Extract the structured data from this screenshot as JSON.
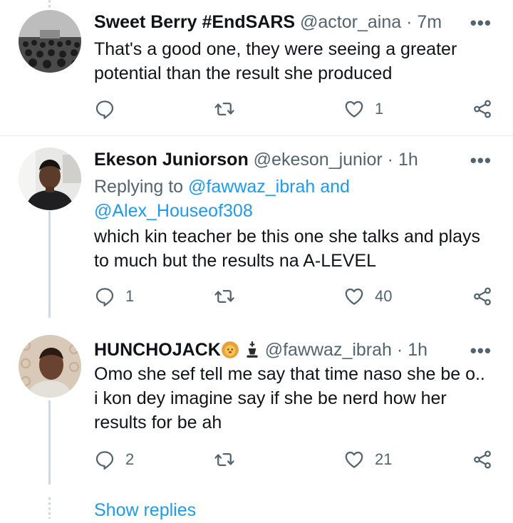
{
  "tweets": [
    {
      "name": "Sweet Berry #EndSARS",
      "handle": "@actor_aina",
      "time": "7m",
      "text": "That's a good one, they were seeing a greater potential than the result she produced",
      "replies": "",
      "likes": "1"
    },
    {
      "name": "Ekeson Juniorson",
      "handle": "@ekeson_junior",
      "time": "1h",
      "replying_label": "Replying to",
      "replying_to_1": "@fawwaz_ibrah",
      "replying_and": "and",
      "replying_to_2": "@Alex_Houseof308",
      "text": "which kin teacher be this one she talks and plays to much but the results na A-LEVEL",
      "replies": "1",
      "likes": "40"
    },
    {
      "name": "HUNCHOJACK",
      "handle": "@fawwaz_ibrah",
      "time": "1h",
      "text": "Omo she sef tell me say that time naso she be o.. i kon dey imagine say if she be nerd how her results for be ah",
      "replies": "2",
      "likes": "21"
    }
  ],
  "separator": "·",
  "more_label": "•••",
  "show_replies": "Show replies",
  "icons": {
    "reply": "reply-icon",
    "retweet": "retweet-icon",
    "like": "heart-icon",
    "share": "share-icon",
    "name_emojis": [
      "lion-emoji",
      "chess-king-emoji"
    ]
  },
  "colors": {
    "link": "#1d9bf0",
    "secondary_text": "#536471",
    "thread_line": "#cfd9de"
  }
}
